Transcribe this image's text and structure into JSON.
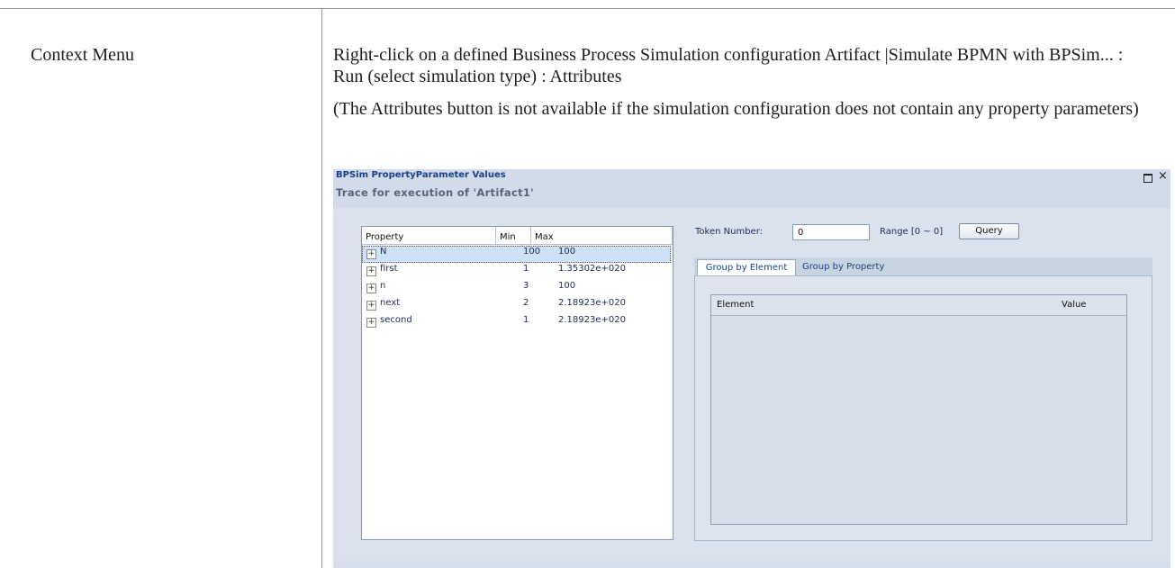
{
  "doc": {
    "row_label": "Context Menu",
    "paragraph1": "Right-click on a defined Business Process Simulation configuration Artifact |Simulate BPMN with BPSim... : Run (select simulation type) : Attributes",
    "paragraph2": "(The Attributes button is not available if the simulation configuration does not contain any property parameters)"
  },
  "dialog": {
    "title": "BPSim PropertyParameter Values",
    "trace": "Trace for execution of 'Artifact1'",
    "window_icons": [
      "restore-icon",
      "close-icon"
    ],
    "close_glyph": "×",
    "property_grid": {
      "columns": [
        "Property",
        "Min",
        "Max"
      ],
      "expand_glyph": "+",
      "rows": [
        {
          "name": "N",
          "min": "100",
          "max": "100",
          "selected": true
        },
        {
          "name": "first",
          "min": "1",
          "max": "1.35302e+020",
          "selected": false
        },
        {
          "name": "n",
          "min": "3",
          "max": "100",
          "selected": false
        },
        {
          "name": "next",
          "min": "2",
          "max": "2.18923e+020",
          "selected": false
        },
        {
          "name": "second",
          "min": "1",
          "max": "2.18923e+020",
          "selected": false
        }
      ]
    },
    "token": {
      "label": "Token Number:",
      "value": "0",
      "range": "Range [0 ~ 0]",
      "query_label": "Query"
    },
    "tabs": [
      {
        "label": "Group by Element",
        "active": true
      },
      {
        "label": "Group by Property",
        "active": false
      }
    ],
    "element_list": {
      "columns": [
        "Element",
        "Value"
      ]
    }
  },
  "colors": {
    "dialog_bg": "#d6dfec",
    "title_blue": "#15428b",
    "selection": "#cfe1f7"
  }
}
